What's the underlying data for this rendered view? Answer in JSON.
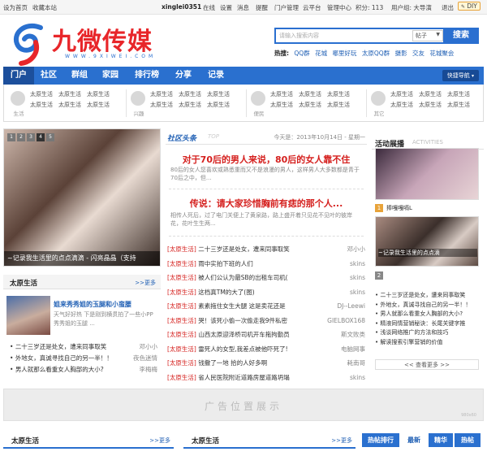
{
  "topbar": {
    "set_home": "设为首页",
    "bookmark": "收藏本站",
    "username": "xinglei0351",
    "online": "在线",
    "settings": "设置",
    "messages": "消息",
    "remind": "提醒",
    "portal_admin": "门户管理",
    "cloud_platform": "云平台",
    "management_center": "管理中心",
    "points": "积分: 113",
    "user_group": "用户组: 大导演",
    "logout": "退出",
    "diy": "DIY"
  },
  "logo": {
    "text": "九微传媒",
    "url_text": "WWW.9XIWEI.COM"
  },
  "search": {
    "placeholder": "请输入搜索内容",
    "scope": "帖子",
    "button": "搜索"
  },
  "hot_search": {
    "label": "热搜:",
    "items": [
      "QQ群",
      "花城",
      "哪里好玩",
      "太原QQ群",
      "摄影",
      "交友",
      "花城聚会"
    ]
  },
  "nav": {
    "items": [
      "门户",
      "社区",
      "群组",
      "家园",
      "排行榜",
      "分享",
      "记录"
    ],
    "quick_nav": "快捷导航"
  },
  "subnav": {
    "groups": [
      {
        "caption": "生活",
        "links": [
          "太原生活",
          "太原生活",
          "太原生活",
          "太原生活",
          "太原生活",
          "太原生活"
        ]
      },
      {
        "caption": "兴趣",
        "links": [
          "太原生活",
          "太原生活",
          "太原生活",
          "太原生活",
          "太原生活",
          "太原生活"
        ]
      },
      {
        "caption": "便民",
        "links": [
          "太原生活",
          "太原生活",
          "太原生活",
          "太原生活",
          "太原生活",
          "太原生活"
        ]
      },
      {
        "caption": "其它",
        "links": [
          "太原生活",
          "太原生活",
          "太原生活",
          "太原生活",
          "太原生活",
          "太原生活"
        ]
      }
    ]
  },
  "slider": {
    "pages": [
      "1",
      "2",
      "3",
      "4",
      "5"
    ],
    "caption": "~记录我生活里的点点滴滴 - 闪亮晶晶（支持"
  },
  "taiyuan_left": {
    "title": "太原生活",
    "more": ">>更多",
    "featured_title": "姐来秀秀姐的玉腿和小蛮腰",
    "featured_desc": "天气好好热 下是刚到横贯拍了一些小PP 秀秀姐的玉腿 ...",
    "list": [
      {
        "title": "二十三岁还是处女，遭来同事取笑",
        "author": "邓小小"
      },
      {
        "title": "外地女，真诚寻找自己的另一半！！",
        "author": "夜色迷情"
      },
      {
        "title": "男人就那么看重女人胸部的大小?",
        "author": "李梅梅"
      }
    ]
  },
  "community": {
    "title": "社区头条",
    "title_en": "TOP",
    "date": "今天是：2013年10月14日 - 星期一",
    "headline1": "对于70后的男人来说，80后的女人靠不住",
    "desc1": "80后的女人您喜欢或熟悉重而又不是浪漫的男人，这样男人大多数都是青于70后之中，但...",
    "headline2": "传说：请大家珍惜胸前有痣的那个人...",
    "desc2": "相传人死后，过了电门关便上了黄泉路，路上盛开着只见花不见叶的彼岸花，花叶生生两...",
    "news": [
      {
        "tag": "[太原生活]",
        "title": "二十三岁还是处女，遭来同事取笑",
        "author": "邓小小"
      },
      {
        "tag": "[太原生活]",
        "title": "雨中实拍下班的人们",
        "author": "skins"
      },
      {
        "tag": "[太原生活]",
        "title": "被人们公认为最SB的出租车司机(",
        "author": "skins"
      },
      {
        "tag": "[太原生活]",
        "title": "这档真TM的大了(图)",
        "author": "skins"
      },
      {
        "tag": "[太原生活]",
        "title": "素素拖住女生大腿 这是卖花还是",
        "author": "DJ--Leewi"
      },
      {
        "tag": "[太原生活]",
        "title": "哭！该死小偷一次偷走我9件私密",
        "author": "GIELBOX168"
      },
      {
        "tag": "[太原生活]",
        "title": "山西太原迎泽桥司机开车拖拘勤员",
        "author": "斯文败类"
      },
      {
        "tag": "[太原生活]",
        "title": "雷死人的女型,我差点被他吓死了!",
        "author": "电脑网事"
      },
      {
        "tag": "[太原生活]",
        "title": "钱撒了一地 拾的人好多啊",
        "author": "耗南哥"
      },
      {
        "tag": "[太原生活]",
        "title": "省人民医院附近道路房屋道路坍塌",
        "author": "skins"
      }
    ]
  },
  "activity": {
    "title": "活动展播",
    "title_en": "ACTIVITIES",
    "item1_num": "1",
    "item1_caption": "捧嘎嘎嗝L",
    "item2_num": "2",
    "item2_caption": "~记录我生活里的点点滴",
    "list": [
      "二十三岁还是处女，遭来同事取笑",
      "外地女，真诚寻找自己的另一半！！",
      "男人就那么看重女人胸部的大小?",
      "精液同情营销秘诀：长尾关键字推",
      "浅谈网络推广的方法和技巧",
      "解读搜索引擎营销的价值"
    ],
    "more": "<< 查看更多 >>"
  },
  "ad": {
    "text": "广告位置展示",
    "tag": "980x60"
  },
  "bottom": {
    "left_title": "太原生活",
    "left_more": ">>更多",
    "mid_title": "太原生活",
    "mid_more": ">>更多",
    "tabs": [
      "热帖排行",
      "最新",
      "精华",
      "热帖"
    ]
  },
  "colors": {
    "brand_blue": "#2a70cf",
    "headline_red": "#d5201e",
    "link_blue": "#1f5fb4"
  }
}
